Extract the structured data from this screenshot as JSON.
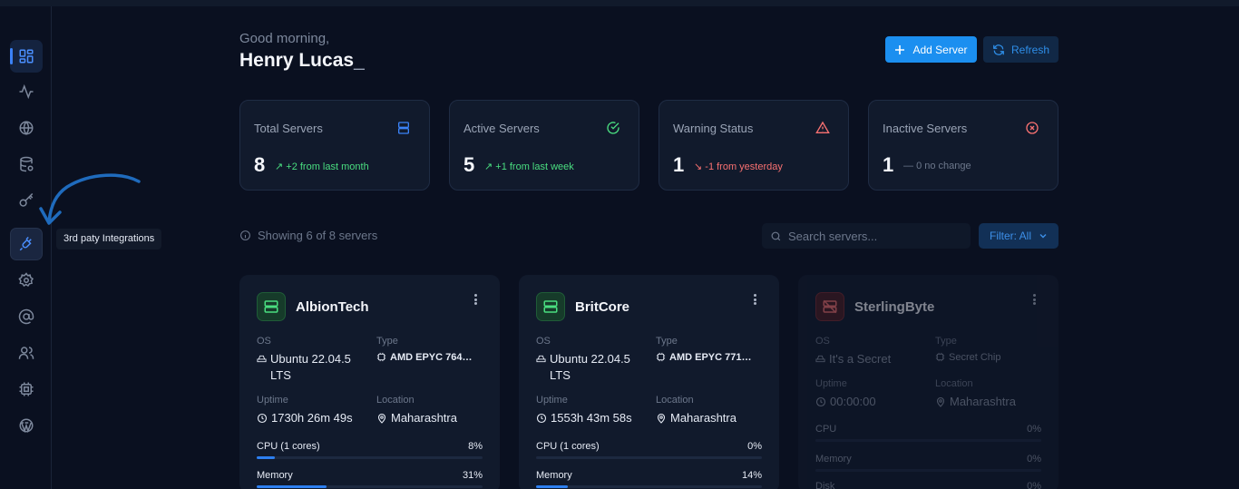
{
  "header": {
    "greeting": "Good morning,",
    "username": "Henry Lucas",
    "cursor": "_",
    "add_server_label": "Add Server",
    "refresh_label": "Refresh"
  },
  "sidebar": {
    "active": "dashboard",
    "tooltip": "3rd paty Integrations",
    "items": [
      "dashboard-icon",
      "activity-icon",
      "globe-icon",
      "database-icon",
      "key-icon",
      "plug-icon",
      "settings-icon",
      "at-icon",
      "users-icon",
      "cpu-icon",
      "wordpress-icon"
    ]
  },
  "stats": [
    {
      "label": "Total Servers",
      "value": "8",
      "trend": "+2 from last month",
      "trend_icon": "↗",
      "color": "#4ade80",
      "icon": "server-icon",
      "icon_color": "#3b82f6"
    },
    {
      "label": "Active Servers",
      "value": "5",
      "trend": "+1 from last week",
      "trend_icon": "↗",
      "color": "#4ade80",
      "icon": "check-circle-icon",
      "icon_color": "#4ade80"
    },
    {
      "label": "Warning Status",
      "value": "1",
      "trend": "-1 from yesterday",
      "trend_icon": "↘",
      "color": "#f87171",
      "icon": "alert-triangle-icon",
      "icon_color": "#f87171"
    },
    {
      "label": "Inactive Servers",
      "value": "1",
      "trend": "0 no change",
      "trend_icon": "—",
      "color": "#6c778b",
      "icon": "x-circle-icon",
      "icon_color": "#f87171"
    }
  ],
  "toolbar": {
    "showing": "Showing 6 of 8 servers",
    "search_placeholder": "Search servers...",
    "filter_label": "Filter: All"
  },
  "labels": {
    "os": "OS",
    "type": "Type",
    "uptime": "Uptime",
    "location": "Location"
  },
  "servers": [
    {
      "name": "AlbionTech",
      "status": "active",
      "os": "Ubuntu 22.04.5 LTS",
      "type": "AMD EPYC 764…",
      "uptime": "1730h 26m 49s",
      "location": "Maharashtra",
      "cpu_label": "CPU (1 cores)",
      "cpu": "8%",
      "cpu_value": 8,
      "memory_label": "Memory",
      "memory": "31%",
      "memory_value": 31
    },
    {
      "name": "BritCore",
      "status": "active",
      "os": "Ubuntu 22.04.5 LTS",
      "type": "AMD EPYC 771…",
      "uptime": "1553h 43m 58s",
      "location": "Maharashtra",
      "cpu_label": "CPU (1 cores)",
      "cpu": "0%",
      "cpu_value": 0,
      "memory_label": "Memory",
      "memory": "14%",
      "memory_value": 14
    },
    {
      "name": "SterlingByte",
      "status": "inactive",
      "os": "It's a Secret",
      "type": "Secret Chip",
      "uptime": "00:00:00",
      "location": "Maharashtra",
      "cpu_label": "CPU",
      "cpu": "0%",
      "cpu_value": 0,
      "memory_label": "Memory",
      "memory": "0%",
      "memory_value": 0,
      "disk_label": "Disk",
      "disk": "0%"
    }
  ]
}
